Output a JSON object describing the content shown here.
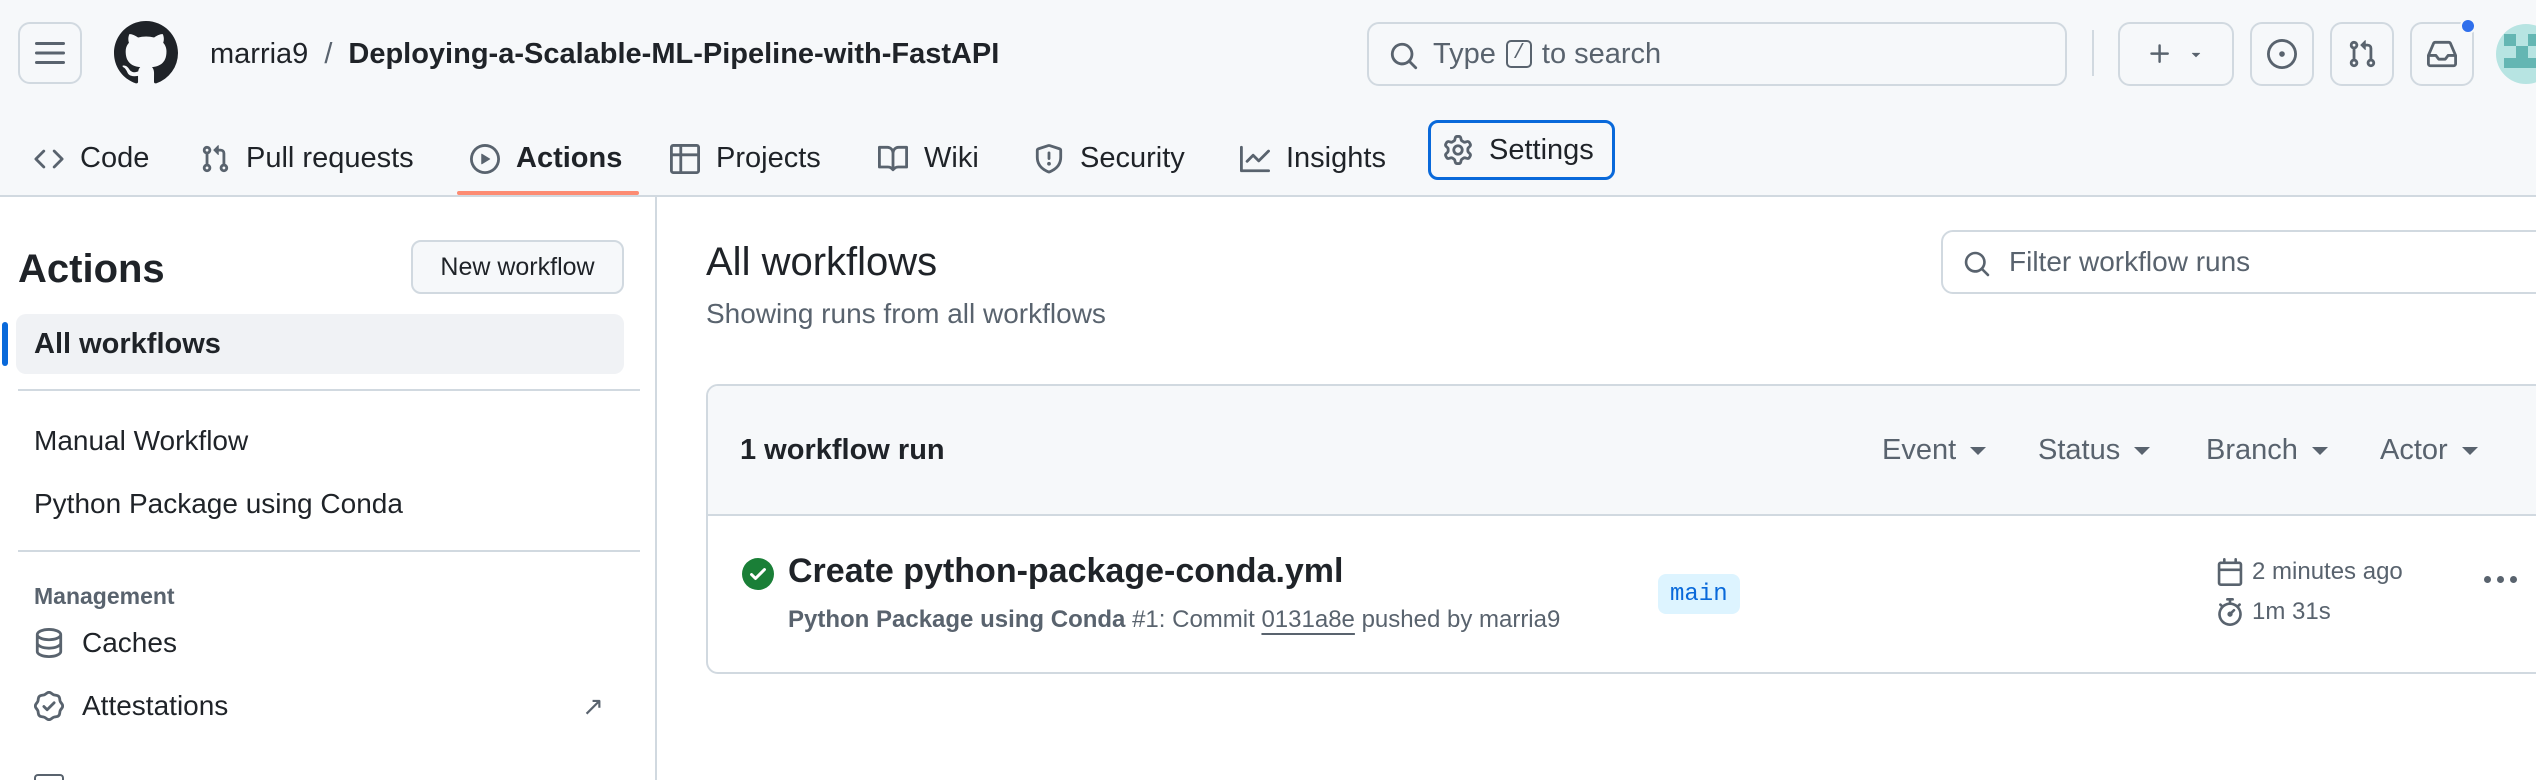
{
  "header": {
    "owner": "marria9",
    "separator": "/",
    "repo": "Deploying-a-Scalable-ML-Pipeline-with-FastAPI",
    "search_prefix": "Type",
    "search_key": "/",
    "search_suffix": "to search"
  },
  "tabs": [
    {
      "label": "Code",
      "icon": "code-icon"
    },
    {
      "label": "Pull requests",
      "icon": "pull-request-icon"
    },
    {
      "label": "Actions",
      "icon": "play-icon"
    },
    {
      "label": "Projects",
      "icon": "table-icon"
    },
    {
      "label": "Wiki",
      "icon": "book-icon"
    },
    {
      "label": "Security",
      "icon": "shield-icon"
    },
    {
      "label": "Insights",
      "icon": "graph-icon"
    },
    {
      "label": "Settings",
      "icon": "gear-icon"
    }
  ],
  "active_tab": "Actions",
  "sidebar": {
    "title": "Actions",
    "new_workflow": "New workflow",
    "all_workflows": "All workflows",
    "workflows": [
      "Manual Workflow",
      "Python Package using Conda"
    ],
    "management_heading": "Management",
    "management": [
      {
        "label": "Caches",
        "icon": "database-icon"
      },
      {
        "label": "Attestations",
        "icon": "verified-icon",
        "external": "↗"
      }
    ]
  },
  "main": {
    "title": "All workflows",
    "subtitle": "Showing runs from all workflows",
    "filter_placeholder": "Filter workflow runs",
    "run_count": "1 workflow run",
    "filters": [
      "Event",
      "Status",
      "Branch",
      "Actor"
    ],
    "runs": [
      {
        "status": "success",
        "title": "Create python-package-conda.yml",
        "workflow": "Python Package using Conda",
        "number": "#1",
        "meta_commit": ": Commit",
        "sha": "0131a8e",
        "meta_pushed": "pushed by marria9",
        "branch": "main",
        "time_ago": "2 minutes ago",
        "duration": "1m 31s"
      }
    ]
  },
  "colors": {
    "accent": "#0969da",
    "success": "#1a7f37",
    "active_tab_underline": "#fd8c73",
    "notification_dot": "#2f6fec"
  }
}
